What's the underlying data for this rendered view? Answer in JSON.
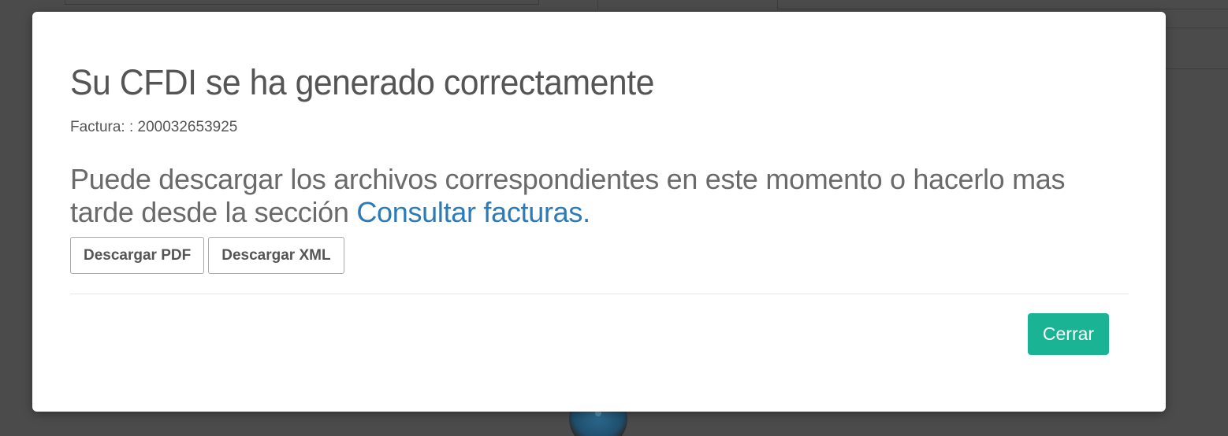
{
  "modal": {
    "title": "Su CFDI se ha generado correctamente",
    "invoice_text": "Factura: : 200032653925",
    "message_text": "Puede descargar los archivos correspondientes en este momento o hacerlo mas tarde desde la sección ",
    "message_link": "Consultar facturas.",
    "download_pdf_label": "Descargar PDF",
    "download_xml_label": "Descargar XML",
    "close_label": "Cerrar"
  },
  "colors": {
    "primary_button": "#1ab394",
    "link": "#2b7bb9",
    "overlay": "#4b4b4b"
  }
}
